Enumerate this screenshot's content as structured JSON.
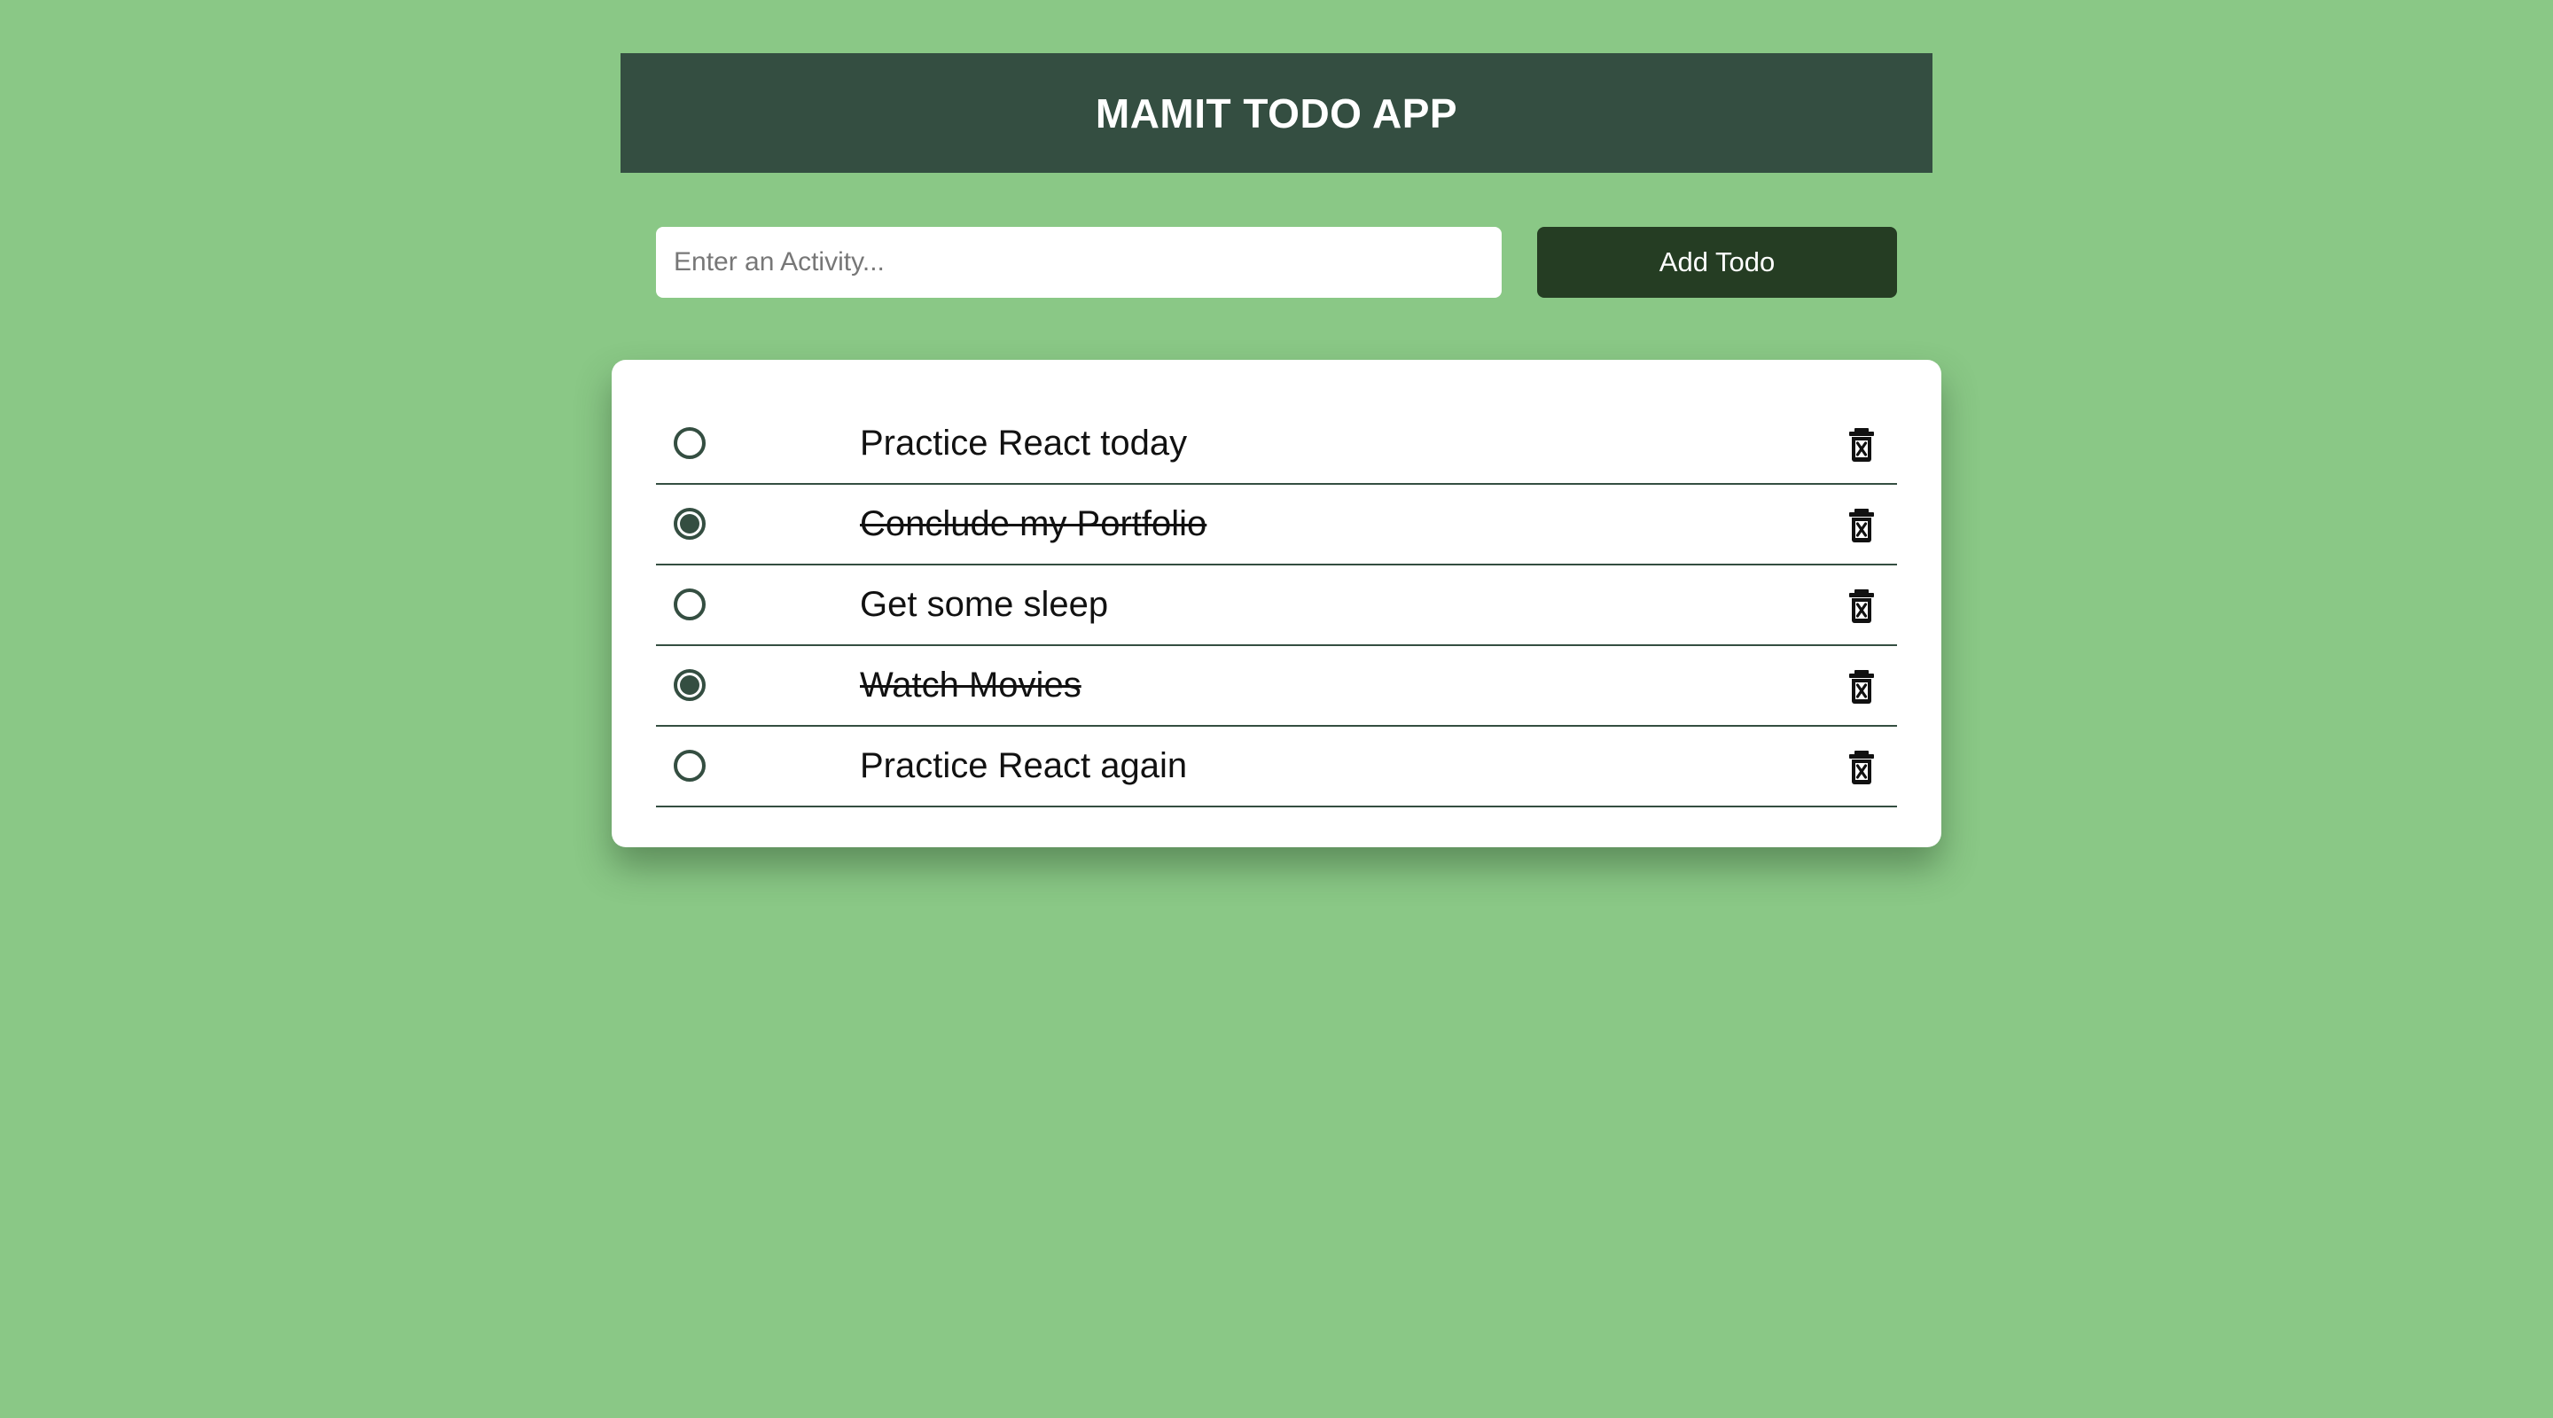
{
  "header": {
    "title": "MAMIT TODO APP"
  },
  "add_form": {
    "placeholder": "Enter an Activity...",
    "value": "",
    "button_label": "Add Todo"
  },
  "todos": [
    {
      "text": "Practice React today",
      "completed": false,
      "delete_icon": "trash-icon"
    },
    {
      "text": "Conclude my Portfolio",
      "completed": true,
      "delete_icon": "trash-icon"
    },
    {
      "text": "Get some sleep",
      "completed": false,
      "delete_icon": "trash-icon"
    },
    {
      "text": "Watch Movies",
      "completed": true,
      "delete_icon": "trash-icon"
    },
    {
      "text": "Practice React again",
      "completed": false,
      "delete_icon": "trash-icon"
    }
  ],
  "colors": {
    "background": "#8ac886",
    "header": "#344e41",
    "button": "#253d23",
    "card": "#ffffff",
    "accent": "#344e41"
  }
}
